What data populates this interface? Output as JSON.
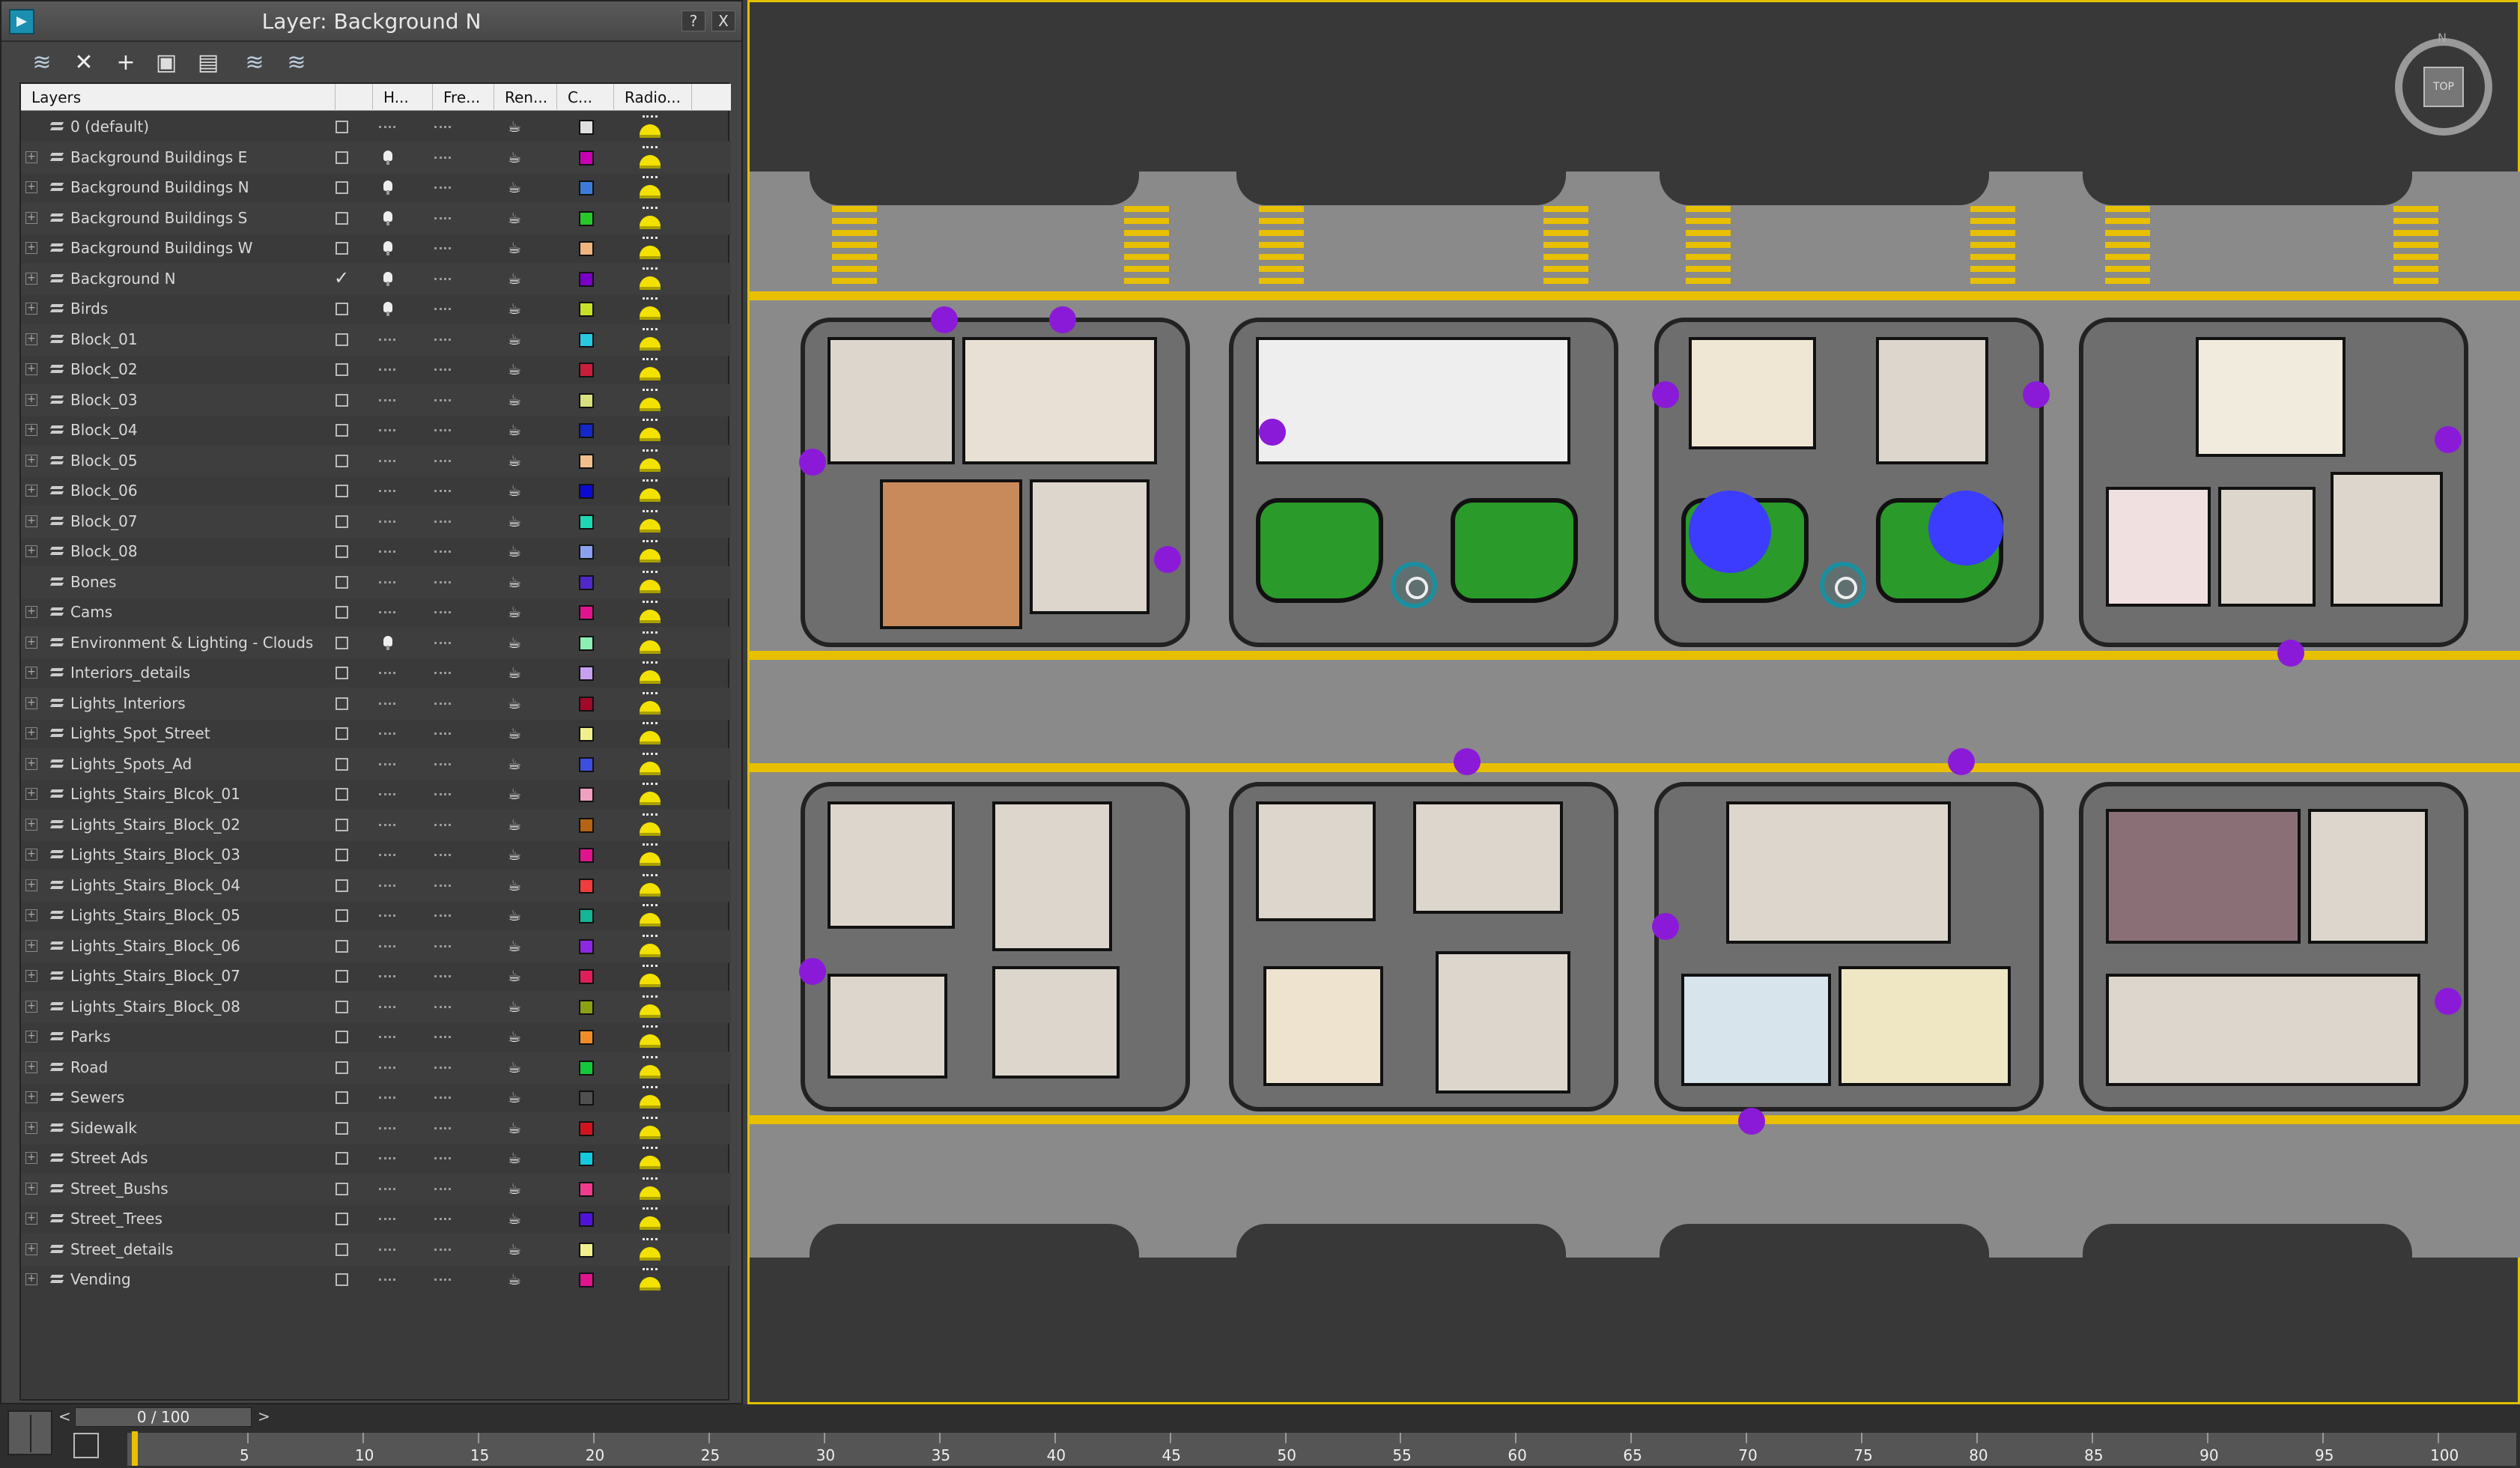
{
  "panel": {
    "title": "Layer: Background N",
    "help_label": "?",
    "close_label": "X"
  },
  "toolbar": {
    "icons": [
      "layers-stack-icon",
      "delete-icon",
      "add-icon",
      "add-selected-icon",
      "select-in-layer-icon",
      "highlight-layer-icon",
      "hide-all-icon"
    ]
  },
  "columns": {
    "layers": "Layers",
    "hide": "H...",
    "freeze": "Fre...",
    "render": "Ren...",
    "color": "C...",
    "radiosity": "Radio..."
  },
  "layers": [
    {
      "name": "0 (default)",
      "expandable": false,
      "checked": false,
      "hidden_light": false,
      "color": "#e0e0e0"
    },
    {
      "name": "Background Buildings E",
      "expandable": true,
      "checked": false,
      "hidden_light": true,
      "color": "#c800b4"
    },
    {
      "name": "Background Buildings N",
      "expandable": true,
      "checked": false,
      "hidden_light": true,
      "color": "#3c7cd8"
    },
    {
      "name": "Background Buildings S",
      "expandable": true,
      "checked": false,
      "hidden_light": true,
      "color": "#28c828"
    },
    {
      "name": "Background Buildings W",
      "expandable": true,
      "checked": false,
      "hidden_light": true,
      "color": "#f0b480"
    },
    {
      "name": "Background N",
      "expandable": true,
      "checked": true,
      "hidden_light": true,
      "color": "#7800c8"
    },
    {
      "name": "Birds",
      "expandable": true,
      "checked": false,
      "hidden_light": true,
      "color": "#c8e028"
    },
    {
      "name": "Block_01",
      "expandable": true,
      "checked": false,
      "hidden_light": false,
      "color": "#28c8e0"
    },
    {
      "name": "Block_02",
      "expandable": true,
      "checked": false,
      "hidden_light": false,
      "color": "#c81e3c"
    },
    {
      "name": "Block_03",
      "expandable": true,
      "checked": false,
      "hidden_light": false,
      "color": "#d8e080"
    },
    {
      "name": "Block_04",
      "expandable": true,
      "checked": false,
      "hidden_light": false,
      "color": "#1428c8"
    },
    {
      "name": "Block_05",
      "expandable": true,
      "checked": false,
      "hidden_light": false,
      "color": "#f0c08c"
    },
    {
      "name": "Block_06",
      "expandable": true,
      "checked": false,
      "hidden_light": false,
      "color": "#0a0ad0"
    },
    {
      "name": "Block_07",
      "expandable": true,
      "checked": false,
      "hidden_light": false,
      "color": "#1ed8b4"
    },
    {
      "name": "Block_08",
      "expandable": true,
      "checked": false,
      "hidden_light": false,
      "color": "#8ca0f0"
    },
    {
      "name": "Bones",
      "expandable": false,
      "checked": false,
      "hidden_light": false,
      "color": "#5028c8"
    },
    {
      "name": "Cams",
      "expandable": true,
      "checked": false,
      "hidden_light": false,
      "color": "#e0148c"
    },
    {
      "name": "Environment & Lighting - Clouds",
      "expandable": true,
      "checked": false,
      "hidden_light": true,
      "color": "#8cf0b4"
    },
    {
      "name": "Interiors_details",
      "expandable": true,
      "checked": false,
      "hidden_light": false,
      "color": "#c8a0f0"
    },
    {
      "name": "Lights_Interiors",
      "expandable": true,
      "checked": false,
      "hidden_light": false,
      "color": "#a00a28"
    },
    {
      "name": "Lights_Spot_Street",
      "expandable": true,
      "checked": false,
      "hidden_light": false,
      "color": "#f0f08c"
    },
    {
      "name": "Lights_Spots_Ad",
      "expandable": true,
      "checked": false,
      "hidden_light": false,
      "color": "#3c50e0"
    },
    {
      "name": "Lights_Stairs_Blcok_01",
      "expandable": true,
      "checked": false,
      "hidden_light": false,
      "color": "#f0a0c0"
    },
    {
      "name": "Lights_Stairs_Block_02",
      "expandable": true,
      "checked": false,
      "hidden_light": false,
      "color": "#b46414"
    },
    {
      "name": "Lights_Stairs_Block_03",
      "expandable": true,
      "checked": false,
      "hidden_light": false,
      "color": "#e0148c"
    },
    {
      "name": "Lights_Stairs_Block_04",
      "expandable": true,
      "checked": false,
      "hidden_light": false,
      "color": "#f03c3c"
    },
    {
      "name": "Lights_Stairs_Block_05",
      "expandable": true,
      "checked": false,
      "hidden_light": false,
      "color": "#14b496"
    },
    {
      "name": "Lights_Stairs_Block_06",
      "expandable": true,
      "checked": false,
      "hidden_light": false,
      "color": "#8c28e0"
    },
    {
      "name": "Lights_Stairs_Block_07",
      "expandable": true,
      "checked": false,
      "hidden_light": false,
      "color": "#e01e5a"
    },
    {
      "name": "Lights_Stairs_Block_08",
      "expandable": true,
      "checked": false,
      "hidden_light": false,
      "color": "#8ca014"
    },
    {
      "name": "Parks",
      "expandable": true,
      "checked": false,
      "hidden_light": false,
      "color": "#f08c28"
    },
    {
      "name": "Road",
      "expandable": true,
      "checked": false,
      "hidden_light": false,
      "color": "#14c83c"
    },
    {
      "name": "Sewers",
      "expandable": true,
      "checked": false,
      "hidden_light": false,
      "color": "#505050"
    },
    {
      "name": "Sidewalk",
      "expandable": true,
      "checked": false,
      "hidden_light": false,
      "color": "#d0141e"
    },
    {
      "name": "Street Ads",
      "expandable": true,
      "checked": false,
      "hidden_light": false,
      "color": "#14c8e0"
    },
    {
      "name": "Street_Bushs",
      "expandable": true,
      "checked": false,
      "hidden_light": false,
      "color": "#f03c8c"
    },
    {
      "name": "Street_Trees",
      "expandable": true,
      "checked": false,
      "hidden_light": false,
      "color": "#5014d8"
    },
    {
      "name": "Street_details",
      "expandable": true,
      "checked": false,
      "hidden_light": false,
      "color": "#f0f08c"
    },
    {
      "name": "Vending",
      "expandable": true,
      "checked": false,
      "hidden_light": false,
      "color": "#e0148c"
    }
  ],
  "viewport": {
    "viewcube_label": "TOP",
    "compass_north": "N"
  },
  "timeline": {
    "frame_display": "0 / 100",
    "prev_label": "<",
    "next_label": ">",
    "ticks": [
      "5",
      "10",
      "15",
      "20",
      "25",
      "30",
      "35",
      "40",
      "45",
      "50",
      "55",
      "60",
      "65",
      "70",
      "75",
      "80",
      "85",
      "90",
      "95",
      "100"
    ]
  },
  "colors": {
    "accent_yellow": "#e8c000",
    "panel_bg": "#444444",
    "viewport_bg": "#383838"
  }
}
